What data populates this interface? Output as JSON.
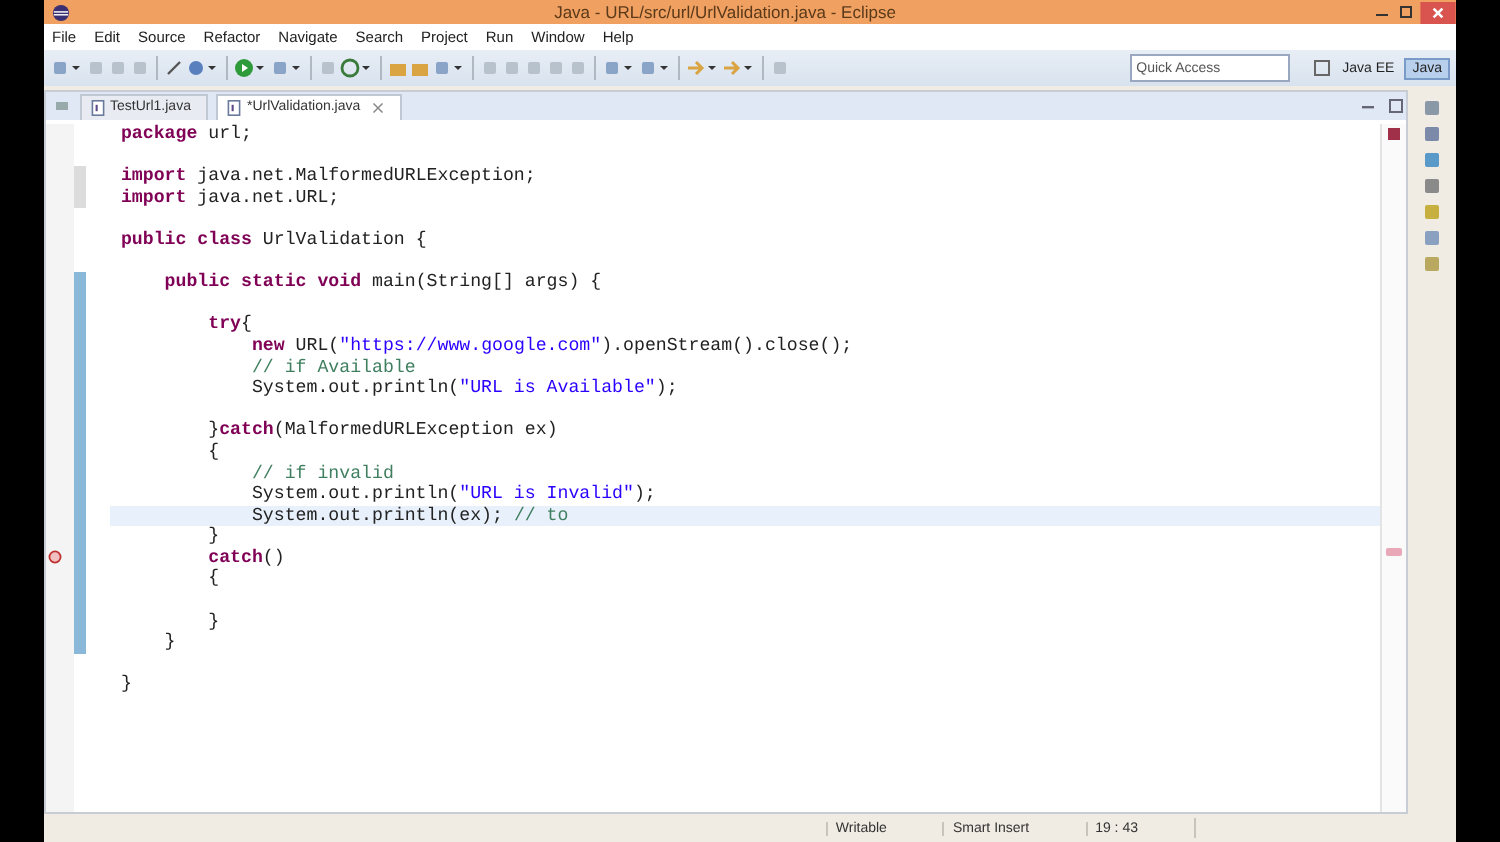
{
  "window": {
    "title": "Java - URL/src/url/UrlValidation.java - Eclipse"
  },
  "menu": [
    "File",
    "Edit",
    "Source",
    "Refactor",
    "Navigate",
    "Search",
    "Project",
    "Run",
    "Window",
    "Help"
  ],
  "quick_access": {
    "placeholder": "Quick Access"
  },
  "perspectives": [
    {
      "label": "Java EE",
      "selected": false
    },
    {
      "label": "Java",
      "selected": true
    }
  ],
  "tabs": [
    {
      "label": "TestUrl1.java",
      "selected": false
    },
    {
      "label": "*UrlValidation.java",
      "selected": true
    }
  ],
  "blocks": [
    {
      "lines": [
        {
          "tokens": [
            {
              "t": "package",
              "kind": "keyword"
            },
            {
              "t": " url;",
              "kind": "plain"
            }
          ],
          "current": false,
          "error": false
        }
      ]
    },
    {
      "lines": [
        {
          "tokens": [
            {
              "t": "import",
              "kind": "keyword"
            },
            {
              "t": " java.net.MalformedURLException;",
              "kind": "plain"
            }
          ],
          "current": false,
          "error": false
        },
        {
          "tokens": [
            {
              "t": "import",
              "kind": "keyword"
            },
            {
              "t": " java.net.URL;",
              "kind": "plain"
            }
          ],
          "current": false,
          "error": false
        }
      ]
    },
    {
      "lines": [
        {
          "tokens": [
            {
              "t": "public class",
              "kind": "keyword"
            },
            {
              "t": " UrlValidation {",
              "kind": "plain"
            }
          ],
          "current": false,
          "error": false
        }
      ]
    },
    {
      "lines": [
        {
          "tokens": [
            {
              "t": "    public static void",
              "kind": "keyword"
            },
            {
              "t": " main(String[] args) {",
              "kind": "plain"
            }
          ],
          "current": false,
          "error": false
        }
      ]
    },
    {
      "lines": [
        {
          "tokens": [
            {
              "t": "        try",
              "kind": "keyword"
            },
            {
              "t": "{",
              "kind": "plain"
            }
          ],
          "current": false,
          "error": false
        },
        {
          "tokens": [
            {
              "t": "            new",
              "kind": "keyword"
            },
            {
              "t": " URL(",
              "kind": "plain"
            },
            {
              "t": "\"https://www.google.com\"",
              "kind": "string"
            },
            {
              "t": ").openStream().close();",
              "kind": "plain"
            }
          ],
          "current": false,
          "error": false
        },
        {
          "tokens": [
            {
              "t": "            // if Available",
              "kind": "comment"
            }
          ],
          "current": false,
          "error": false
        },
        {
          "tokens": [
            {
              "t": "            System.out.println(",
              "kind": "plain"
            },
            {
              "t": "\"URL is Available\"",
              "kind": "string"
            },
            {
              "t": ");",
              "kind": "plain"
            }
          ],
          "current": false,
          "error": false
        }
      ]
    },
    {
      "lines": [
        {
          "tokens": [
            {
              "t": "        }",
              "kind": "plain"
            },
            {
              "t": "catch",
              "kind": "keyword"
            },
            {
              "t": "(MalformedURLException ex)",
              "kind": "plain"
            }
          ],
          "current": false,
          "error": false
        },
        {
          "tokens": [
            {
              "t": "        {",
              "kind": "plain"
            }
          ],
          "current": false,
          "error": false
        },
        {
          "tokens": [
            {
              "t": "            // if invalid",
              "kind": "comment"
            }
          ],
          "current": false,
          "error": false
        },
        {
          "tokens": [
            {
              "t": "            System.out.println(",
              "kind": "plain"
            },
            {
              "t": "\"URL is Invalid\"",
              "kind": "string"
            },
            {
              "t": ");",
              "kind": "plain"
            }
          ],
          "current": false,
          "error": false
        },
        {
          "tokens": [
            {
              "t": "            System.out.println(ex); ",
              "kind": "plain"
            },
            {
              "t": "// to",
              "kind": "comment"
            }
          ],
          "current": true,
          "error": false
        },
        {
          "tokens": [
            {
              "t": "        }",
              "kind": "plain"
            }
          ],
          "current": false,
          "error": false
        },
        {
          "tokens": [
            {
              "t": "        catch",
              "kind": "keyword"
            },
            {
              "t": "()",
              "kind": "plain"
            }
          ],
          "current": false,
          "error": true
        },
        {
          "tokens": [
            {
              "t": "        {",
              "kind": "plain"
            }
          ],
          "current": false,
          "error": false
        }
      ]
    },
    {
      "lines": [
        {
          "tokens": [
            {
              "t": "        }",
              "kind": "plain"
            }
          ],
          "current": false,
          "error": false
        },
        {
          "tokens": [
            {
              "t": "    }",
              "kind": "plain"
            }
          ],
          "current": false,
          "error": false
        }
      ]
    },
    {
      "lines": [
        {
          "tokens": [
            {
              "t": "}",
              "kind": "plain"
            }
          ],
          "current": false,
          "error": false
        }
      ]
    }
  ],
  "status_bar": [
    "Writable",
    "Smart Insert",
    "19 : 43"
  ]
}
